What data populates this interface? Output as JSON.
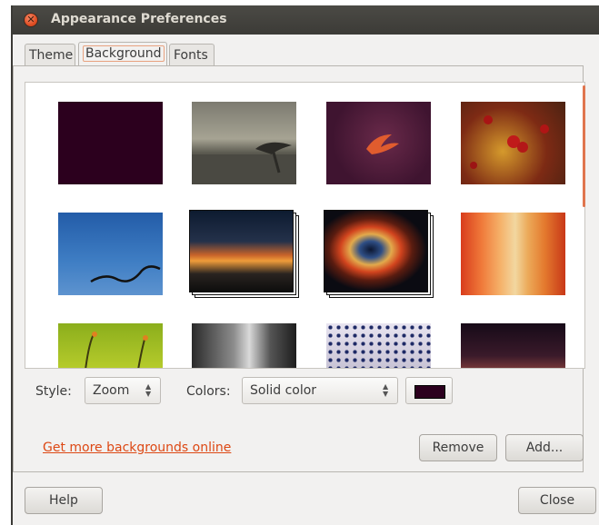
{
  "window": {
    "title": "Appearance Preferences"
  },
  "tabs": [
    {
      "label": "Theme",
      "active": false
    },
    {
      "label": "Background",
      "active": true
    },
    {
      "label": "Fonts",
      "active": false
    }
  ],
  "backgrounds": {
    "thumbnail_count_visible": 12,
    "selected_index": 0
  },
  "style": {
    "label": "Style:",
    "value": "Zoom"
  },
  "colors": {
    "label": "Colors:",
    "value": "Solid color",
    "swatch": "#2c001e"
  },
  "link": {
    "text": "Get more backgrounds online"
  },
  "buttons": {
    "remove": "Remove",
    "add": "Add...",
    "help": "Help",
    "close": "Close"
  },
  "theme": {
    "accent": "#dd4814",
    "titlebar": "#3c3b37"
  }
}
